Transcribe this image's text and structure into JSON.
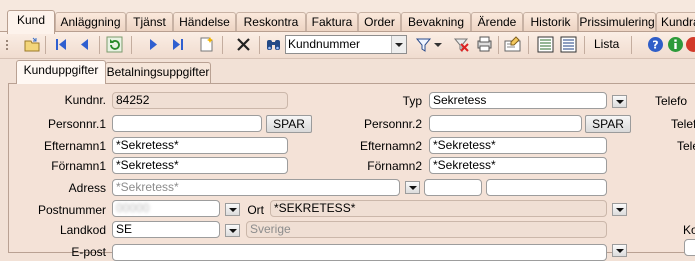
{
  "module_tabs": [
    "Kund",
    "Anläggning",
    "Tjänst",
    "Händelse",
    "Reskontra",
    "Faktura",
    "Order",
    "Bevakning",
    "Ärende",
    "Historik",
    "Prissimulering",
    "Kundra"
  ],
  "toolbar": {
    "search_field": "Kundnummer",
    "lista_label": "Lista"
  },
  "sub_tabs": [
    "Kunduppgifter",
    "Betalningsuppgifter"
  ],
  "form": {
    "kundnr_label": "Kundnr.",
    "kundnr_value": "84252",
    "typ_label": "Typ",
    "typ_value": "Sekretess",
    "personnr1_label": "Personnr.1",
    "personnr1_value": "",
    "personnr2_label": "Personnr.2",
    "personnr2_value": "",
    "spar_label": "SPAR",
    "efternamn1_label": "Efternamn1",
    "efternamn1_value": "*Sekretess*",
    "efternamn2_label": "Efternamn2",
    "efternamn2_value": "*Sekretess*",
    "fornamn1_label": "Förnamn1",
    "fornamn1_value": "*Sekretess*",
    "fornamn2_label": "Förnamn2",
    "fornamn2_value": "*Sekretess*",
    "adress_label": "Adress",
    "adress_placeholder": "*Sekretess*",
    "postnummer_label": "Postnummer",
    "postnummer_value": "00000",
    "ort_label": "Ort",
    "ort_value": "*SEKRETESS*",
    "landkod_label": "Landkod",
    "landkod_value": "SE",
    "land_name": "Sverige",
    "epost_label": "E-post"
  },
  "right_labels": [
    "Telefo",
    "Telef",
    "Tele",
    "Ko"
  ],
  "colors": {
    "background": "#f2e1d6",
    "active_tab": "#fdf3ec",
    "readonly_field": "#f0dfd4"
  }
}
